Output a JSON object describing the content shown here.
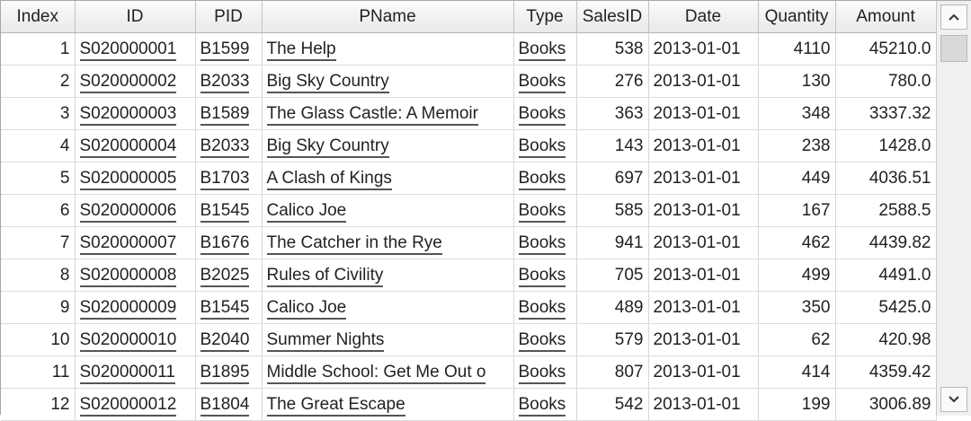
{
  "columns": [
    "Index",
    "ID",
    "PID",
    "PName",
    "Type",
    "SalesID",
    "Date",
    "Quantity",
    "Amount"
  ],
  "rows": [
    [
      "1",
      "S020000001",
      "B1599",
      "The Help",
      "Books",
      "538",
      "2013-01-01",
      "4110",
      "45210.0"
    ],
    [
      "2",
      "S020000002",
      "B2033",
      "Big Sky Country",
      "Books",
      "276",
      "2013-01-01",
      "130",
      "780.0"
    ],
    [
      "3",
      "S020000003",
      "B1589",
      "The Glass Castle: A Memoir",
      "Books",
      "363",
      "2013-01-01",
      "348",
      "3337.32"
    ],
    [
      "4",
      "S020000004",
      "B2033",
      "Big Sky Country",
      "Books",
      "143",
      "2013-01-01",
      "238",
      "1428.0"
    ],
    [
      "5",
      "S020000005",
      "B1703",
      "A Clash of Kings",
      "Books",
      "697",
      "2013-01-01",
      "449",
      "4036.51"
    ],
    [
      "6",
      "S020000006",
      "B1545",
      "Calico Joe",
      "Books",
      "585",
      "2013-01-01",
      "167",
      "2588.5"
    ],
    [
      "7",
      "S020000007",
      "B1676",
      "The Catcher in the Rye",
      "Books",
      "941",
      "2013-01-01",
      "462",
      "4439.82"
    ],
    [
      "8",
      "S020000008",
      "B2025",
      "Rules of Civility",
      "Books",
      "705",
      "2013-01-01",
      "499",
      "4491.0"
    ],
    [
      "9",
      "S020000009",
      "B1545",
      "Calico Joe",
      "Books",
      "489",
      "2013-01-01",
      "350",
      "5425.0"
    ],
    [
      "10",
      "S020000010",
      "B2040",
      "Summer Nights",
      "Books",
      "579",
      "2013-01-01",
      "62",
      "420.98"
    ],
    [
      "11",
      "S020000011",
      "B1895",
      "Middle School: Get Me Out o",
      "Books",
      "807",
      "2013-01-01",
      "414",
      "4359.42"
    ],
    [
      "12",
      "S020000012",
      "B1804",
      "The Great Escape",
      "Books",
      "542",
      "2013-01-01",
      "199",
      "3006.89"
    ]
  ],
  "scrollbar": {
    "up_icon": "chevron-up-icon",
    "down_icon": "chevron-down-icon"
  },
  "colors": {
    "blue_number": "#1919cc",
    "red_number": "#a45c5c",
    "header_bg": "#efefef"
  }
}
